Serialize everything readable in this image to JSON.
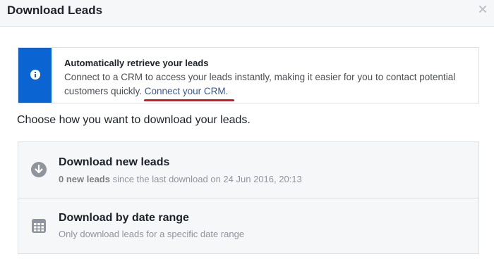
{
  "dialog": {
    "title": "Download Leads",
    "close_icon": "close-icon"
  },
  "info": {
    "icon": "info-icon",
    "accent_color": "#0a64d2",
    "heading": "Automatically retrieve your leads",
    "text": "Connect to a CRM to access your leads instantly, making it easier for you to contact potential customers quickly. ",
    "link_label": "Connect your CRM",
    "link_suffix": "."
  },
  "prompt": "Choose how you want to download your leads.",
  "options": [
    {
      "icon": "download-arrow-icon",
      "title": "Download new leads",
      "count_label": "0 new leads",
      "subtitle": " since the last download on 24 Jun 2016, 20:13"
    },
    {
      "icon": "calendar-icon",
      "title": "Download by date range",
      "subtitle": "Only download leads for a specific date range"
    }
  ]
}
